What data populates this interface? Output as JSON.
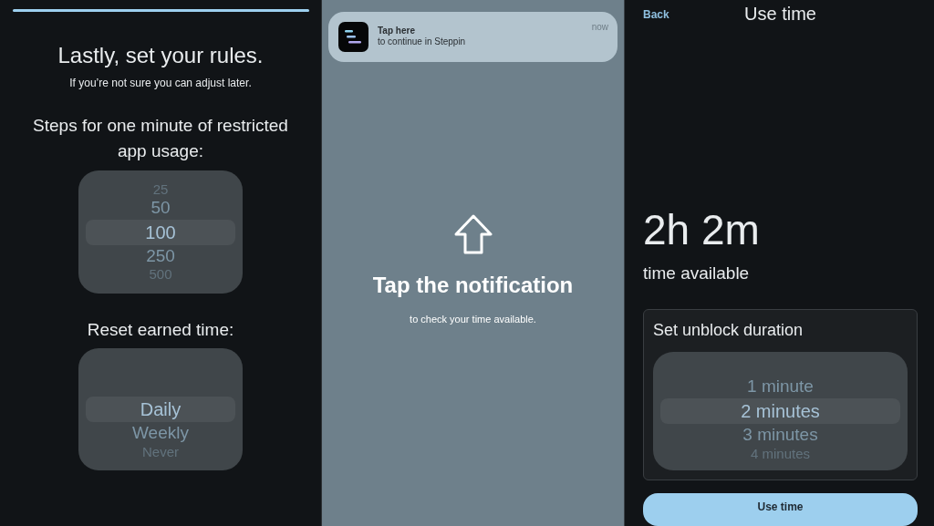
{
  "rules_screen": {
    "progress": {
      "level": 1
    },
    "title": "Lastly, set your rules.",
    "subtitle": "If you’re not sure you can adjust later.",
    "pickers": [
      {
        "label": "Steps for one minute of restricted app usage:",
        "options": [
          {
            "label": "25",
            "selected": false
          },
          {
            "label": "50",
            "selected": false
          },
          {
            "label": "100",
            "selected": true
          },
          {
            "label": "250",
            "selected": false
          },
          {
            "label": "500",
            "selected": false
          }
        ]
      },
      {
        "label": "Reset earned time:",
        "options": [
          {
            "label": "Daily",
            "selected": true
          },
          {
            "label": "Weekly",
            "selected": false
          },
          {
            "label": "Never",
            "selected": false
          }
        ]
      }
    ]
  },
  "notification_screen": {
    "notification": {
      "title": "Tap here",
      "body": "to continue in Steppin",
      "time": "now"
    },
    "heading": "Tap the notification",
    "caption": "to check your time available."
  },
  "use_time_screen": {
    "back": "Back",
    "title": "Use time",
    "time_value": "2h 2m",
    "time_label": "time available",
    "card": {
      "label": "Set unblock duration",
      "options": [
        {
          "label": "1 minute",
          "selected": false
        },
        {
          "label": "2 minutes",
          "selected": true
        },
        {
          "label": "3 minutes",
          "selected": false
        },
        {
          "label": "4 minutes",
          "selected": false
        }
      ]
    },
    "button": "Use time"
  }
}
